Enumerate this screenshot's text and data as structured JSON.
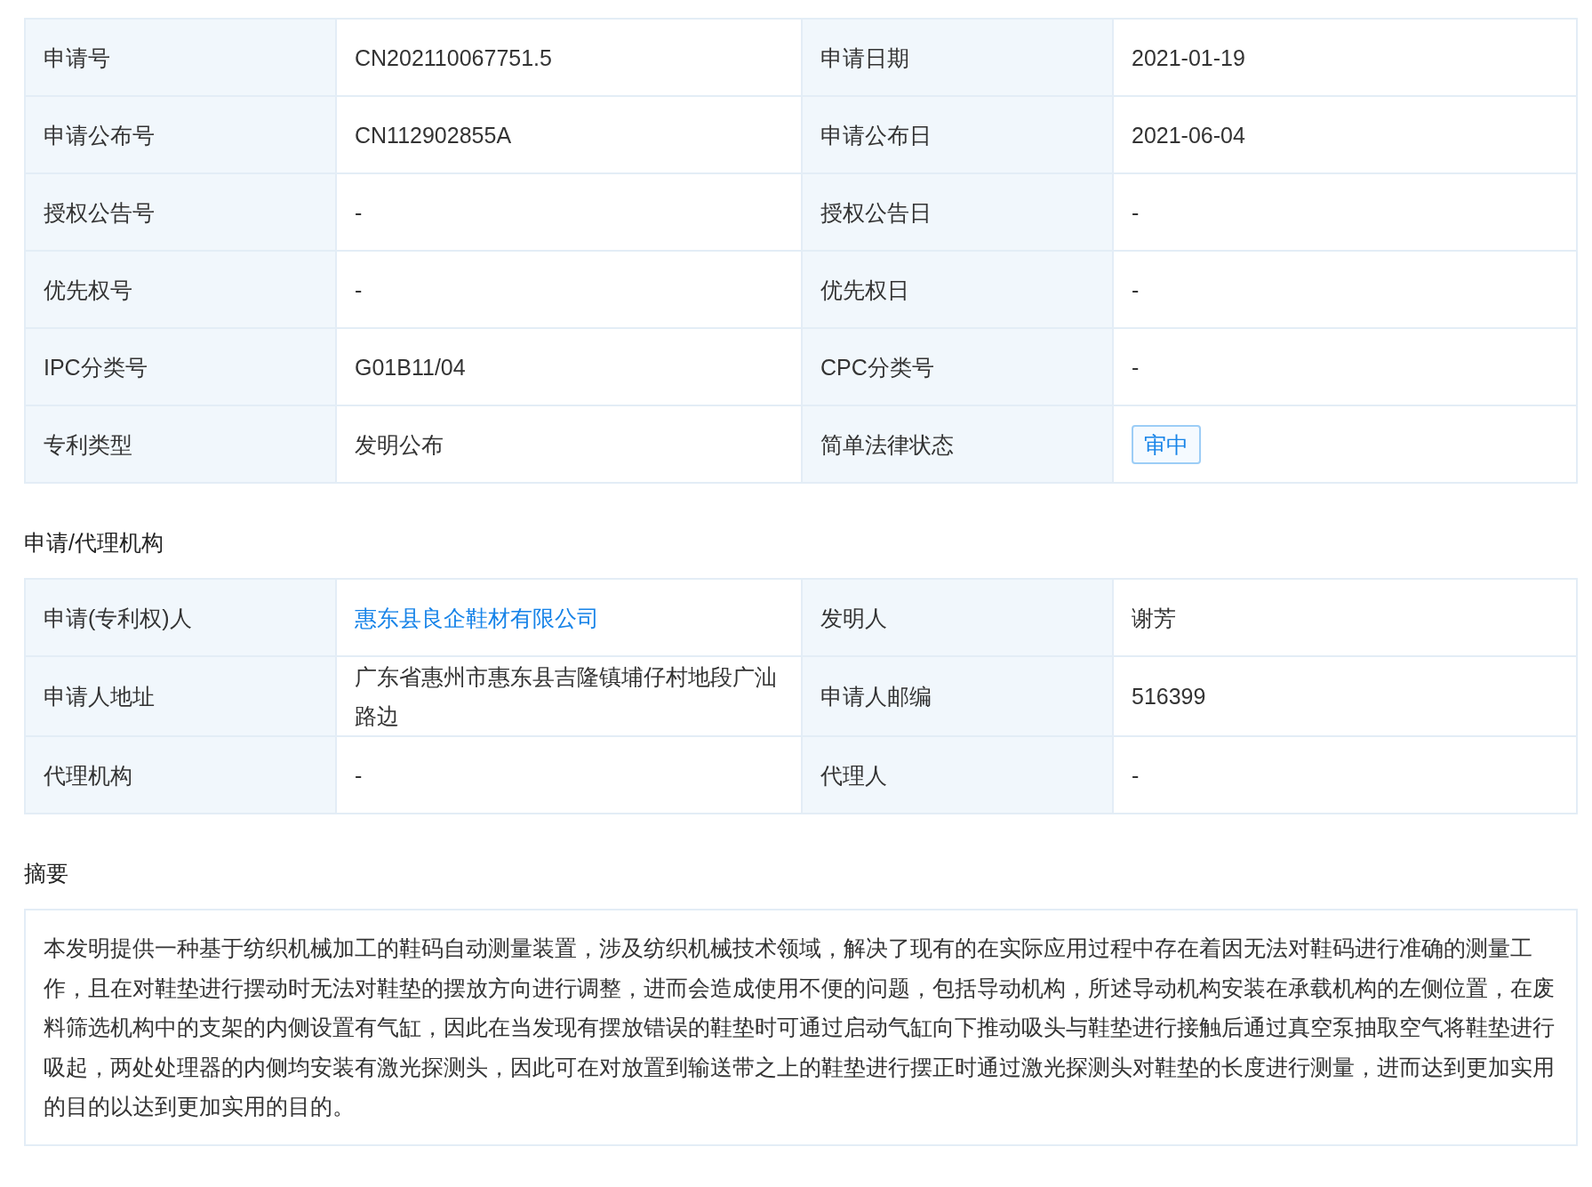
{
  "basic_info": {
    "fields": [
      {
        "label": "申请号",
        "value": "CN202110067751.5",
        "kind": "text"
      },
      {
        "label": "申请日期",
        "value": "2021-01-19",
        "kind": "text"
      },
      {
        "label": "申请公布号",
        "value": "CN112902855A",
        "kind": "text"
      },
      {
        "label": "申请公布日",
        "value": "2021-06-04",
        "kind": "text"
      },
      {
        "label": "授权公告号",
        "value": "-",
        "kind": "text"
      },
      {
        "label": "授权公告日",
        "value": "-",
        "kind": "text"
      },
      {
        "label": "优先权号",
        "value": "-",
        "kind": "text"
      },
      {
        "label": "优先权日",
        "value": "-",
        "kind": "text"
      },
      {
        "label": "IPC分类号",
        "value": "G01B11/04",
        "kind": "text"
      },
      {
        "label": "CPC分类号",
        "value": "-",
        "kind": "text"
      },
      {
        "label": "专利类型",
        "value": "发明公布",
        "kind": "text"
      },
      {
        "label": "简单法律状态",
        "value": "审中",
        "kind": "tag"
      }
    ]
  },
  "agency": {
    "title": "申请/代理机构",
    "fields": [
      {
        "label": "申请(专利权)人",
        "value": "惠东县良企鞋材有限公司",
        "kind": "link"
      },
      {
        "label": "发明人",
        "value": "谢芳",
        "kind": "text"
      },
      {
        "label": "申请人地址",
        "value": "广东省惠州市惠东县吉隆镇埔仔村地段广汕路边",
        "kind": "text"
      },
      {
        "label": "申请人邮编",
        "value": "516399",
        "kind": "text"
      },
      {
        "label": "代理机构",
        "value": "-",
        "kind": "text"
      },
      {
        "label": "代理人",
        "value": "-",
        "kind": "text"
      }
    ]
  },
  "abstract": {
    "title": "摘要",
    "text": "本发明提供一种基于纺织机械加工的鞋码自动测量装置，涉及纺织机械技术领域，解决了现有的在实际应用过程中存在着因无法对鞋码进行准确的测量工作，且在对鞋垫进行摆动时无法对鞋垫的摆放方向进行调整，进而会造成使用不便的问题，包括导动机构，所述导动机构安装在承载机构的左侧位置，在废料筛选机构中的支架的内侧设置有气缸，因此在当发现有摆放错误的鞋垫时可通过启动气缸向下推动吸头与鞋垫进行接触后通过真空泵抽取空气将鞋垫进行吸起，两处处理器的内侧均安装有激光探测头，因此可在对放置到输送带之上的鞋垫进行摆正时通过激光探测头对鞋垫的长度进行测量，进而达到更加实用的目的以达到更加实用的目的。"
  }
}
